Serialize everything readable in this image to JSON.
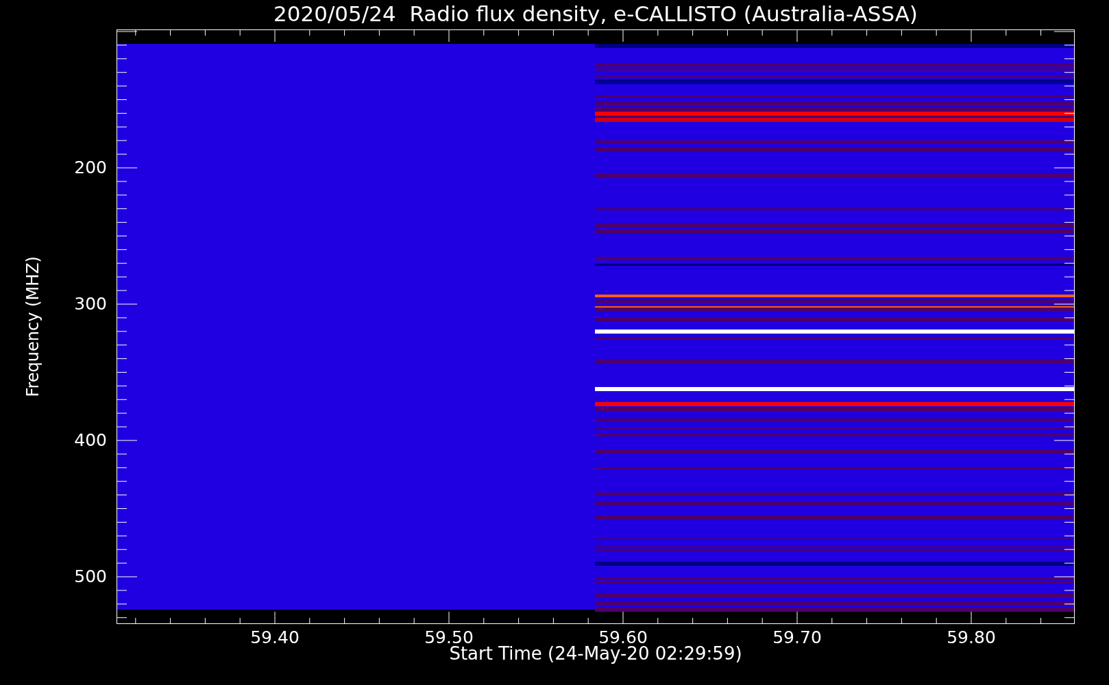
{
  "title": "2020/05/24  Radio flux density, e-CALLISTO (Australia-ASSA)",
  "y_axis": {
    "label": "Frequency (MHZ)",
    "ticks": [
      "200",
      "300",
      "400",
      "500"
    ]
  },
  "x_axis": {
    "label": "Start Time (24-May-20 02:29:59)",
    "ticks": [
      "59.40",
      "59.50",
      "59.60",
      "59.70",
      "59.80"
    ]
  }
}
